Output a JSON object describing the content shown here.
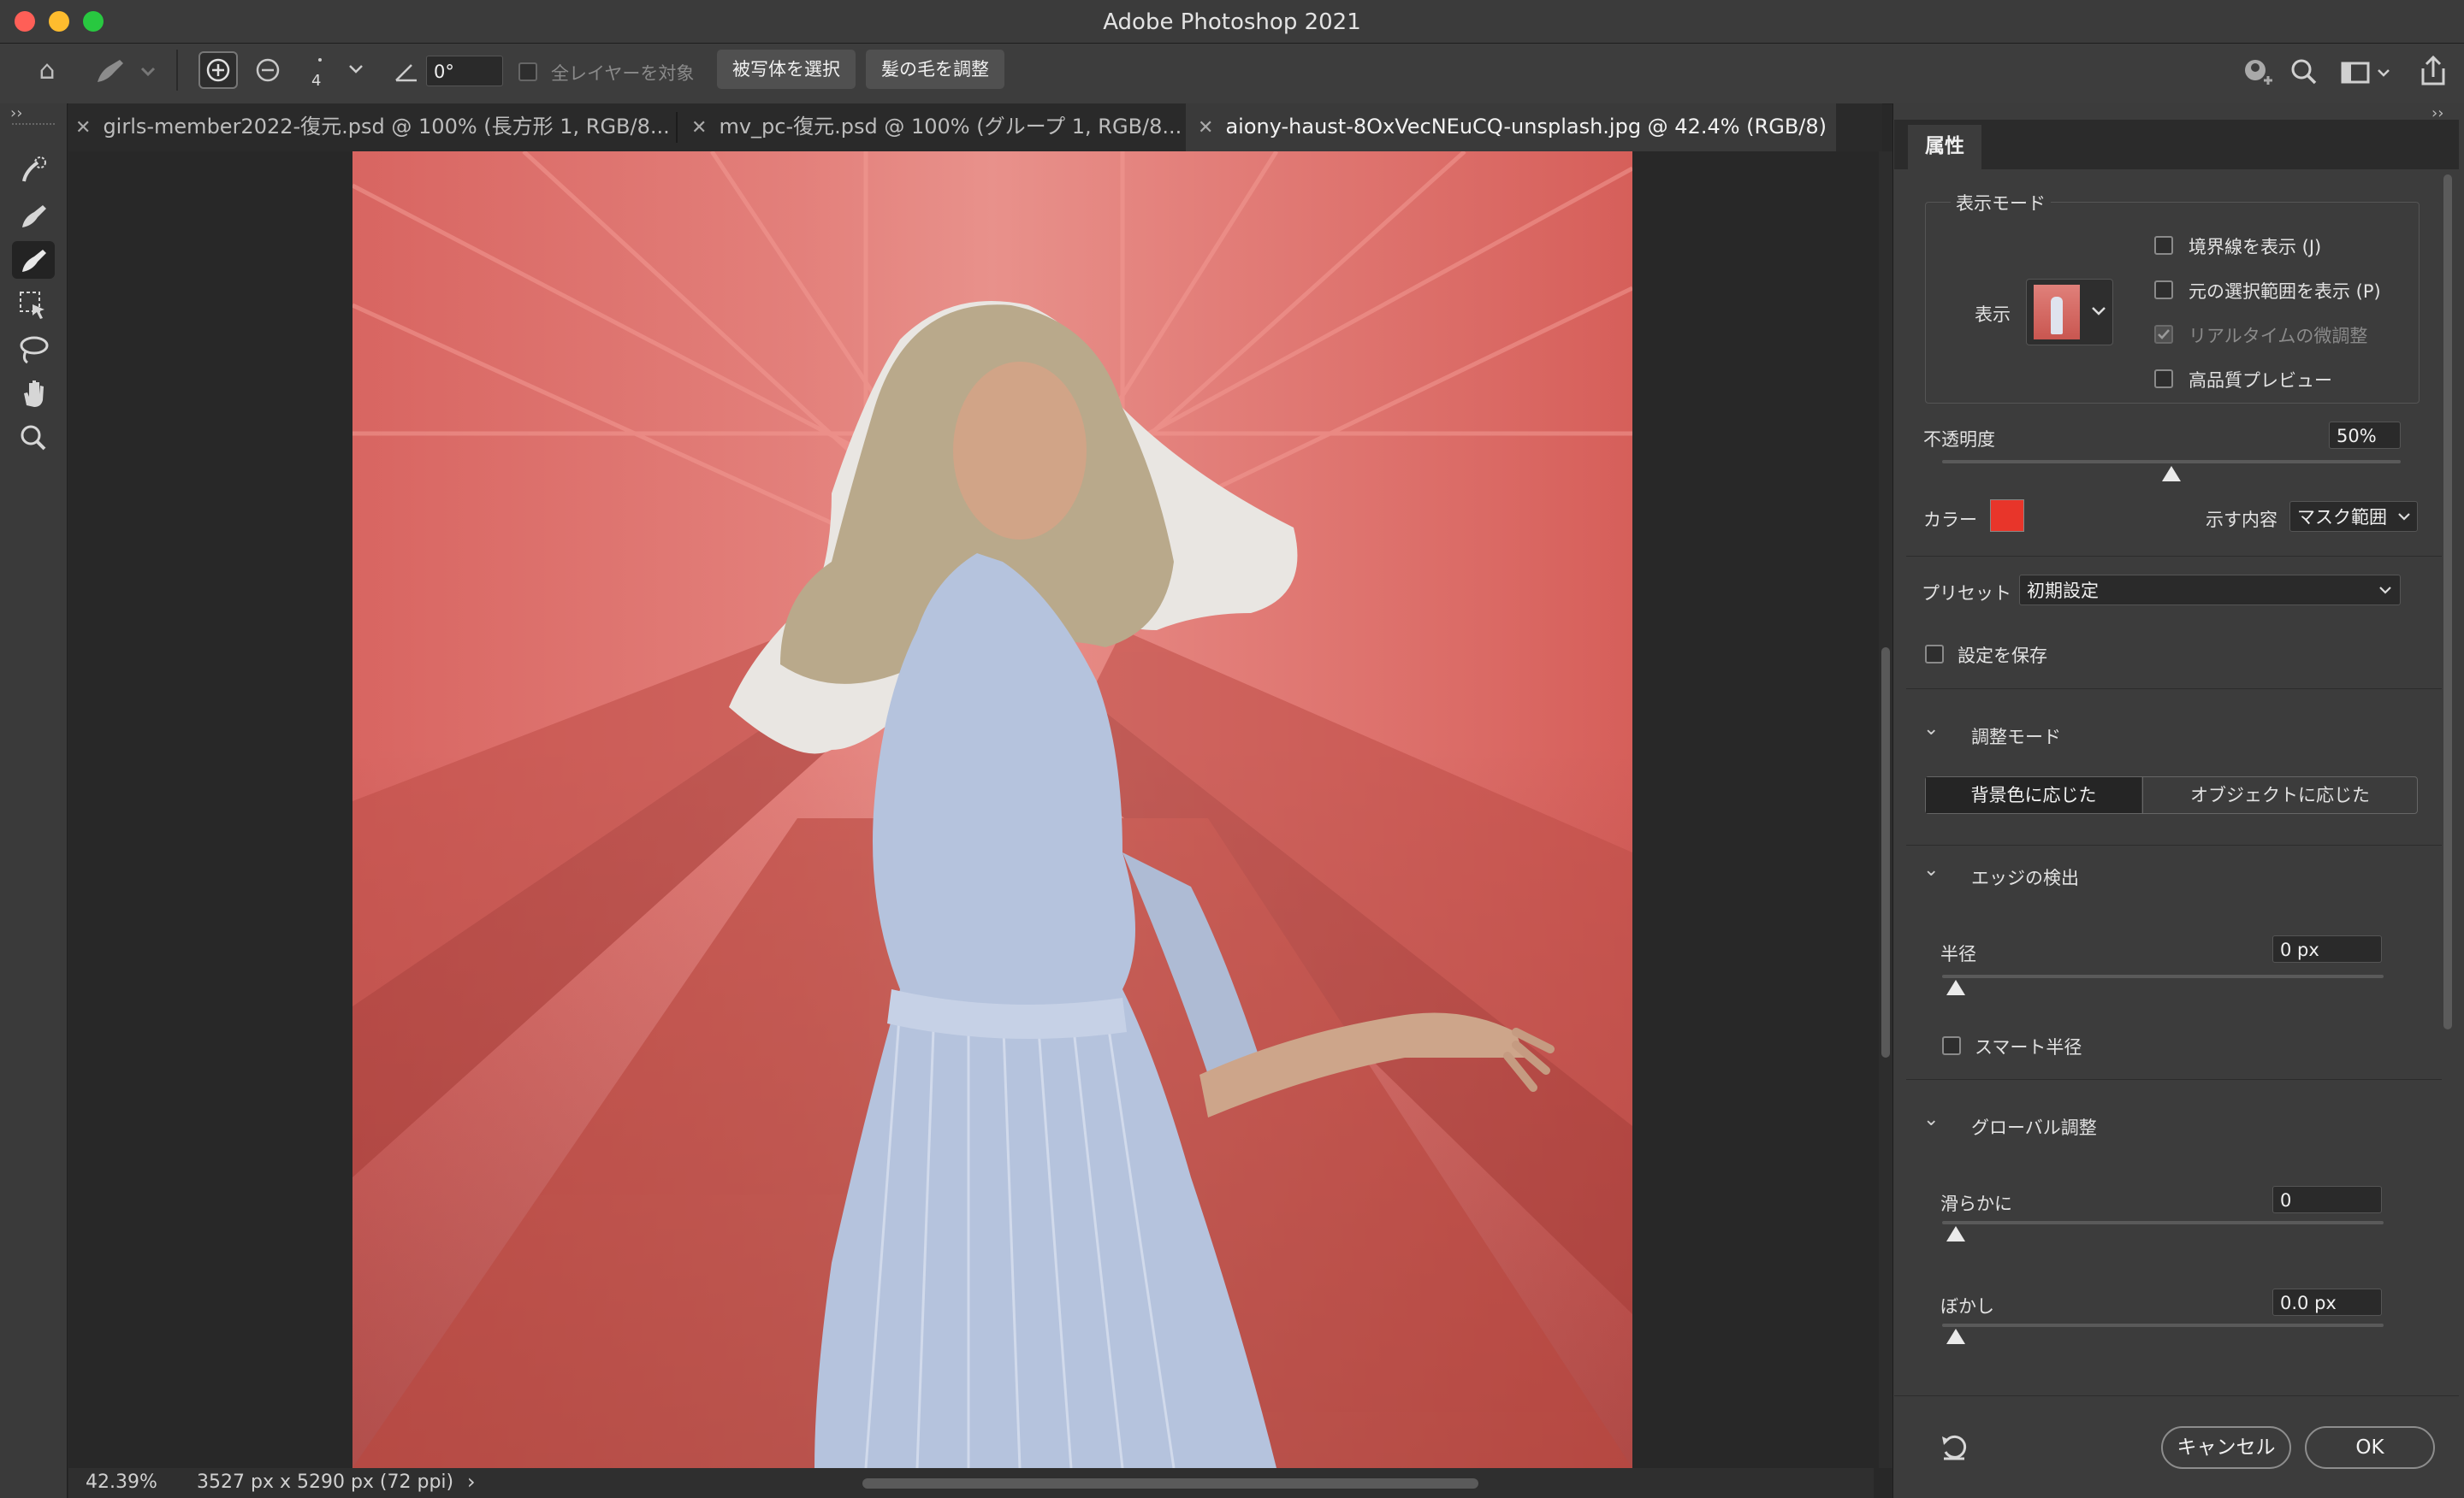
{
  "window": {
    "title": "Adobe Photoshop 2021"
  },
  "colors": {
    "mask_color": "#e8352a",
    "overlay_red": "#e3807b"
  },
  "options_bar": {
    "brush_size": "4",
    "angle": "0°",
    "sample_all_layers": "全レイヤーを対象",
    "select_subject": "被写体を選択",
    "refine_hair": "髪の毛を調整"
  },
  "tabs": [
    {
      "label": "girls-member2022-復元.psd @ 100% (長方形 1, RGB/8..."
    },
    {
      "label": "mv_pc-復元.psd @ 100% (グループ 1, RGB/8..."
    },
    {
      "label": "aiony-haust-8OxVecNEuCQ-unsplash.jpg @ 42.4% (RGB/8)"
    }
  ],
  "status": {
    "zoom": "42.39%",
    "doc_info": "3527 px x 5290 px (72 ppi)"
  },
  "panel": {
    "tab_label": "属性",
    "view_mode": {
      "heading": "表示モード",
      "view_label": "表示",
      "show_edge": "境界線を表示 (J)",
      "show_original": "元の選択範囲を表示 (P)",
      "realtime_refine": "リアルタイムの微調整",
      "hq_preview": "高品質プレビュー"
    },
    "opacity": {
      "label": "不透明度",
      "value": "50%",
      "percent": 50
    },
    "color": {
      "label": "カラー",
      "indicates_label": "示す内容",
      "indicates_value": "マスク範囲"
    },
    "preset": {
      "label": "プリセット",
      "value": "初期設定",
      "save_label": "設定を保存"
    },
    "refine_mode": {
      "heading": "調整モード",
      "option1": "背景色に応じた",
      "option2": "オブジェクトに応じた"
    },
    "edge_detection": {
      "heading": "エッジの検出",
      "radius_label": "半径",
      "radius_value": "0 px",
      "smart_radius": "スマート半径"
    },
    "global": {
      "heading": "グローバル調整",
      "smooth_label": "滑らかに",
      "smooth_value": "0",
      "feather_label": "ぼかし",
      "feather_value": "0.0 px"
    },
    "cancel": "キャンセル",
    "ok": "OK"
  }
}
